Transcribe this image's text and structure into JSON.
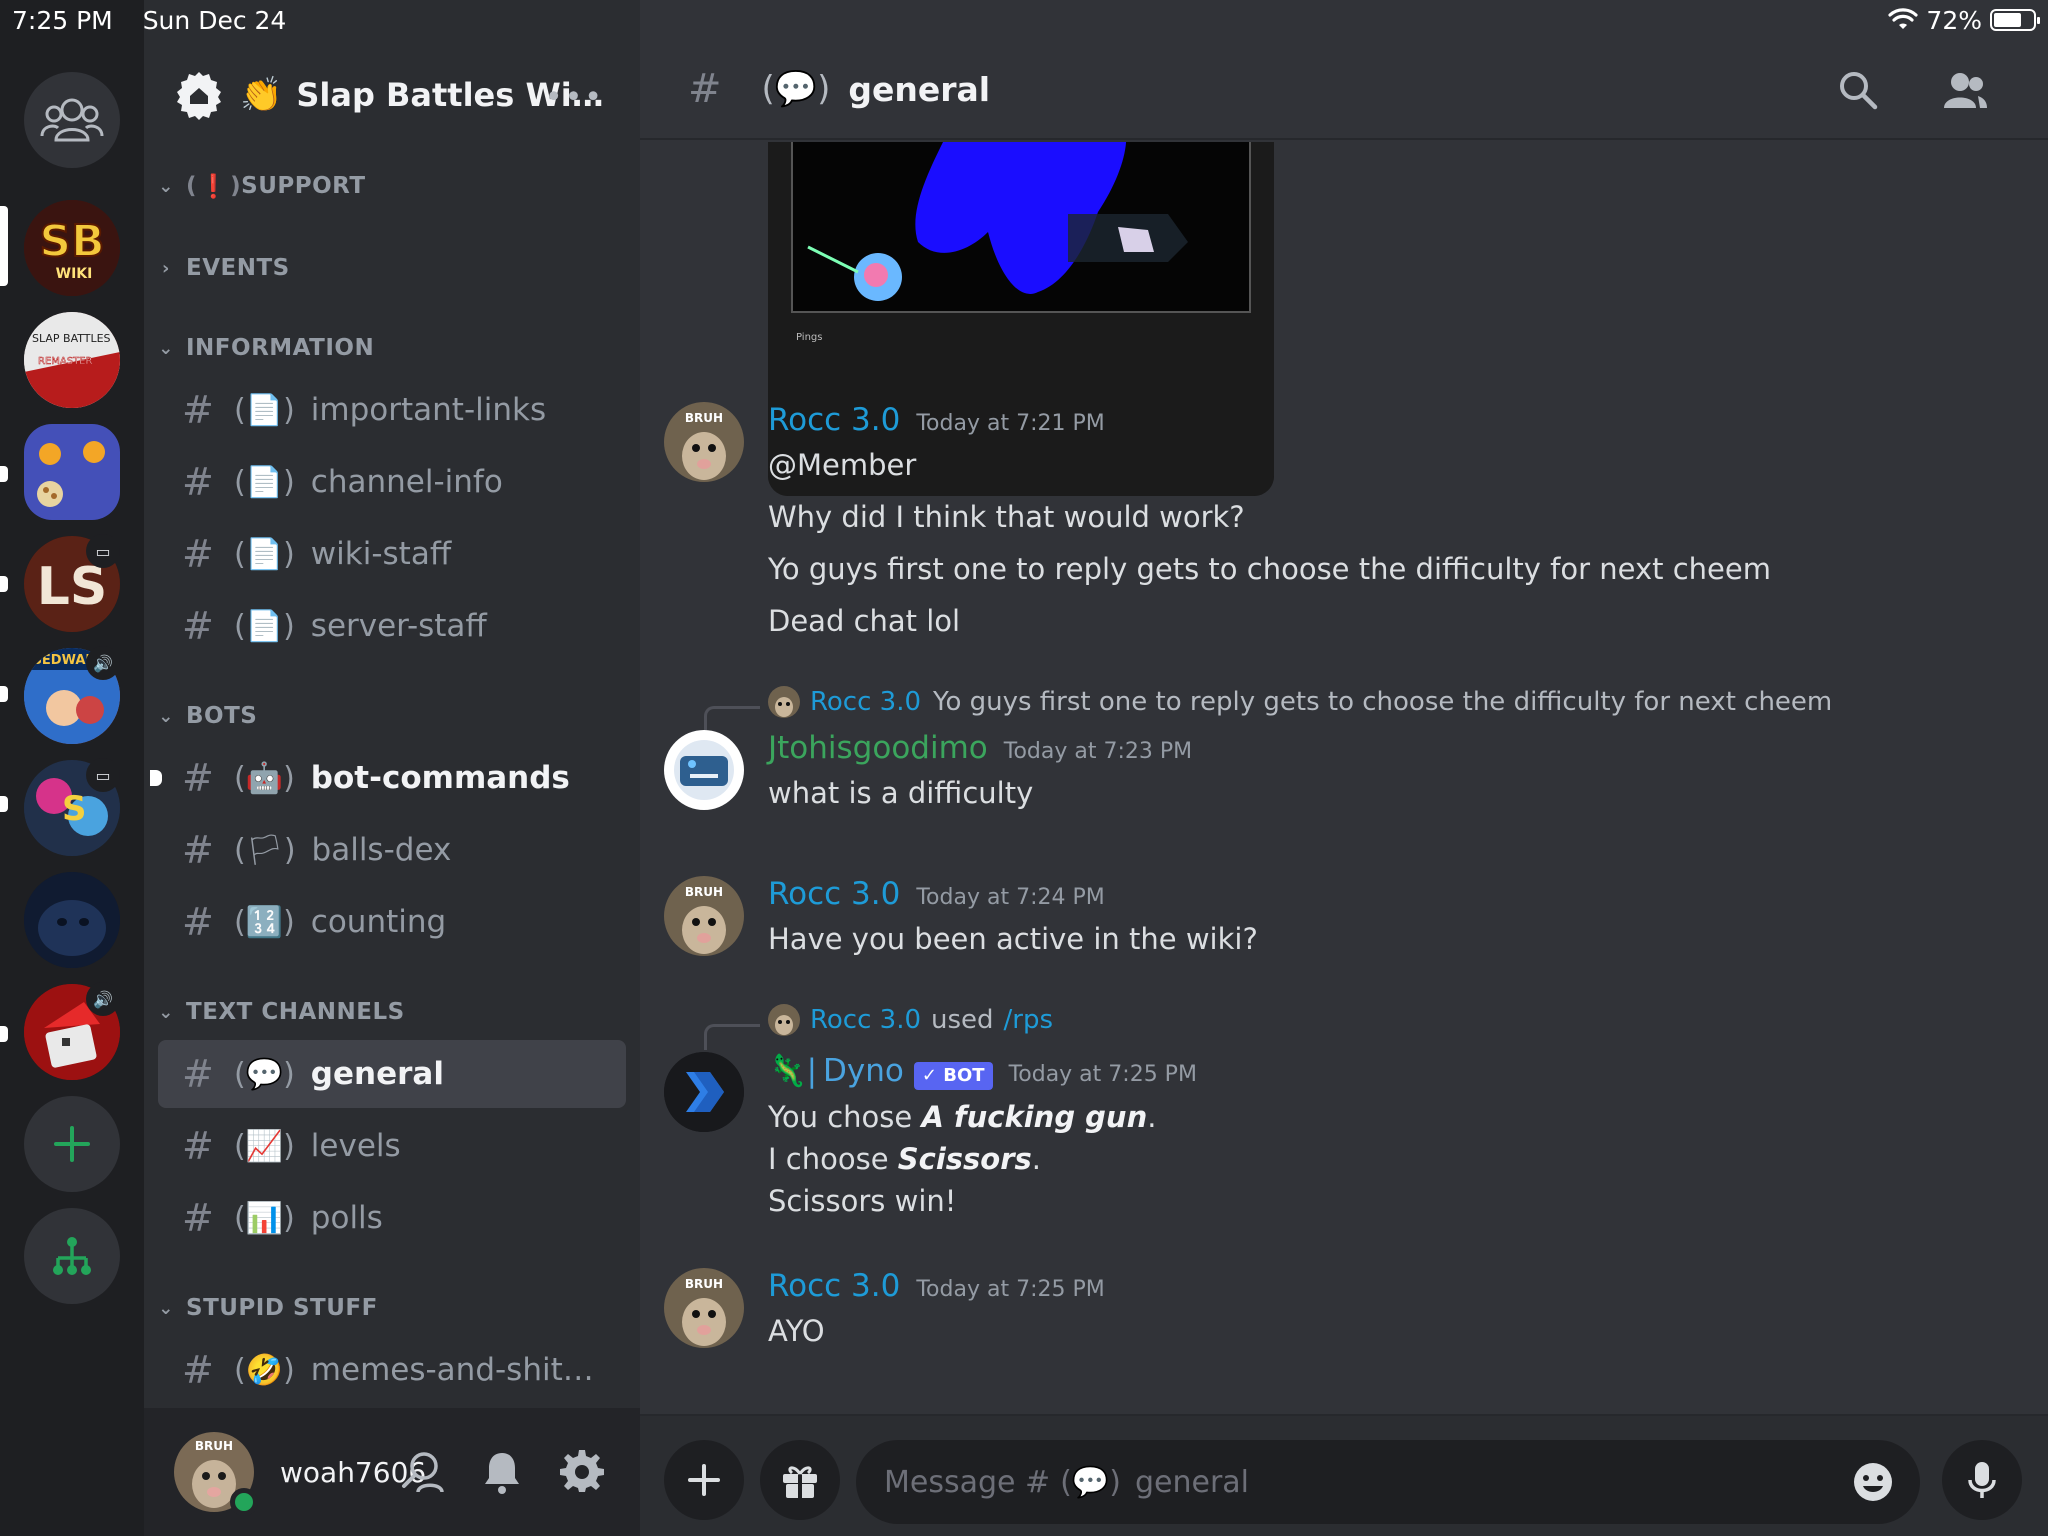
{
  "status_bar": {
    "time": "7:25 PM",
    "date": "Sun Dec 24",
    "battery": "72%",
    "battery_level": 0.72
  },
  "guild": {
    "name": "Slap Battles Wi…",
    "emoji": "👏"
  },
  "categories": {
    "support": "SUPPORT",
    "support_prefix": "❗",
    "events": "EVENTS",
    "information": "INFORMATION",
    "bots": "BOTS",
    "text_channels": "TEXT CHANNELS",
    "stupid_stuff": "STUPID STUFF"
  },
  "channels": {
    "important_links": {
      "name": "important-links",
      "emoji": "📄"
    },
    "channel_info": {
      "name": "channel-info",
      "emoji": "📄"
    },
    "wiki_staff": {
      "name": "wiki-staff",
      "emoji": "📄"
    },
    "server_staff": {
      "name": "server-staff",
      "emoji": "📄"
    },
    "bot_commands": {
      "name": "bot-commands",
      "emoji": "🤖"
    },
    "balls_dex": {
      "name": "balls-dex",
      "emoji": "🏳"
    },
    "counting": {
      "name": "counting",
      "emoji": "🔢"
    },
    "general": {
      "name": "general",
      "emoji": "💬"
    },
    "levels": {
      "name": "levels",
      "emoji": "📈"
    },
    "polls": {
      "name": "polls",
      "emoji": "📊"
    },
    "memes": {
      "name": "memes-and-shit…",
      "emoji": "🤣"
    }
  },
  "user": {
    "name": "woah7606",
    "avatar_text": "BRUH"
  },
  "chat_header": {
    "hash": "#",
    "emoji": "💬",
    "title": "general"
  },
  "messages": {
    "m1": {
      "author": "Rocc 3.0",
      "time": "Today at 7:21 PM",
      "lines": [
        "@Member",
        "Why did I think that would work?",
        "Yo guys first one to reply gets to choose the difficulty for next cheem",
        "Dead chat lol"
      ]
    },
    "m2": {
      "reply_author": "Rocc 3.0",
      "reply_text": "Yo guys first one to reply gets to choose the difficulty for next cheem",
      "author": "Jtohisgoodimo",
      "time": "Today at 7:23 PM",
      "text": "what is a difficulty"
    },
    "m3": {
      "author": "Rocc 3.0",
      "time": "Today at 7:24 PM",
      "text": "Have you been active in the wiki?"
    },
    "m4": {
      "used_author": "Rocc 3.0",
      "used_word": "used",
      "command": "/rps",
      "author": "Dyno",
      "author_prefix": "🦎|",
      "bot_tag": "BOT",
      "time": "Today at 7:25 PM",
      "l1_pre": "You chose ",
      "l1_bold": "A fucking gun",
      "l1_post": ".",
      "l2_pre": "I choose ",
      "l2_bold": "Scissors",
      "l2_post": ".",
      "l3": "Scissors win!"
    },
    "m5": {
      "author": "Rocc 3.0",
      "time": "Today at 7:25 PM",
      "text": "AYO"
    }
  },
  "embed_caption": "Pings",
  "composer": {
    "prefix": "Message #",
    "emoji": "💬",
    "channel": "general"
  },
  "colors": {
    "accent_blue": "#1e9bd7",
    "accent_green": "#3ba55d",
    "online": "#23a55a",
    "bot_tag": "#5865f2"
  }
}
